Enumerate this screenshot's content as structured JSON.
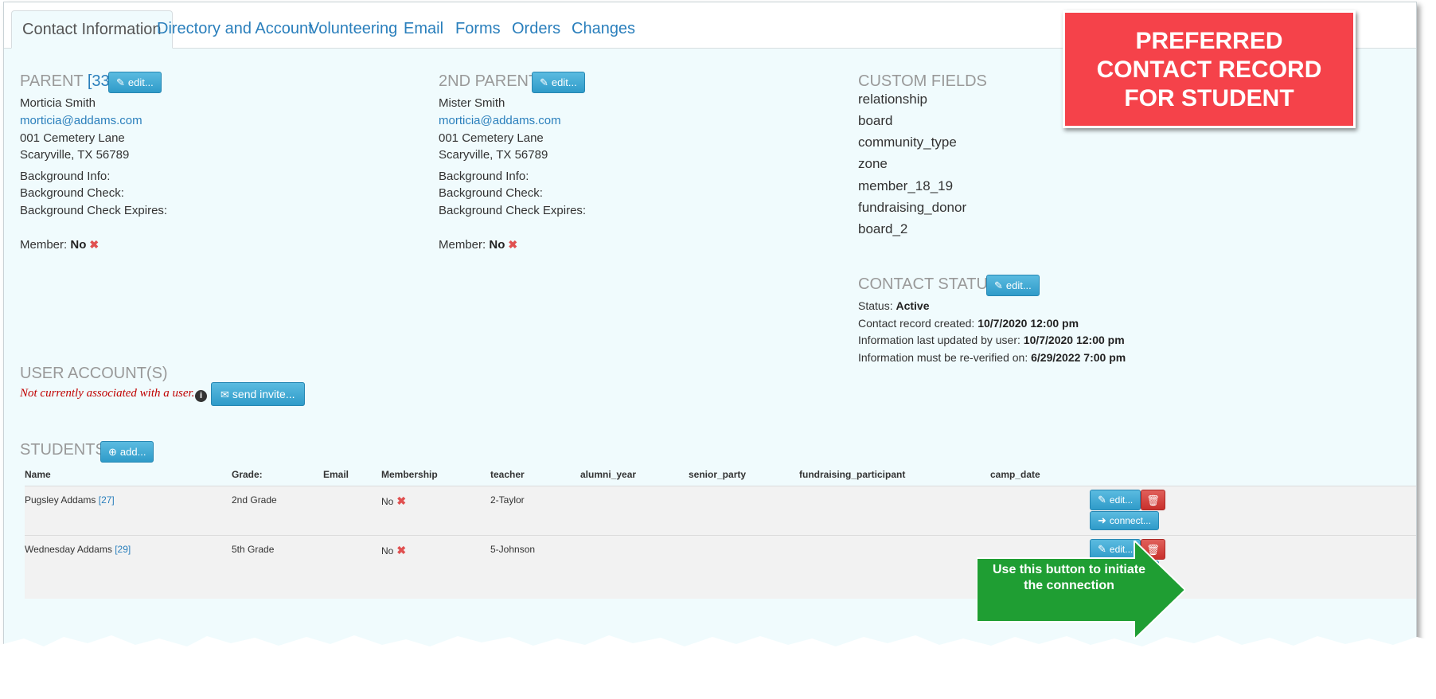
{
  "tabs": [
    {
      "label": "Contact Information",
      "active": true
    },
    {
      "label": "Directory and Account"
    },
    {
      "label": "Volunteering"
    },
    {
      "label": "Email"
    },
    {
      "label": "Forms"
    },
    {
      "label": "Orders"
    },
    {
      "label": "Changes"
    }
  ],
  "parent": {
    "title": "PARENT",
    "id": "[33]",
    "edit_label": "edit...",
    "name": "Morticia Smith",
    "email": "morticia@addams.com",
    "address1": "001 Cemetery Lane",
    "address2": "Scaryville, TX 56789",
    "bg_info": "Background Info:",
    "bg_check": "Background Check:",
    "bg_expires": "Background Check Expires:",
    "member_label": "Member:",
    "member_value": "No"
  },
  "parent2": {
    "title": "2ND PARENT",
    "edit_label": "edit...",
    "name": "Mister Smith",
    "email": "morticia@addams.com",
    "address1": "001 Cemetery Lane",
    "address2": "Scaryville, TX 56789",
    "bg_info": "Background Info:",
    "bg_check": "Background Check:",
    "bg_expires": "Background Check Expires:",
    "member_label": "Member:",
    "member_value": "No"
  },
  "custom_fields": {
    "title": "CUSTOM FIELDS",
    "items": [
      "relationship",
      "board",
      "community_type",
      "zone",
      "member_18_19",
      "fundraising_donor",
      "board_2"
    ]
  },
  "contact_status": {
    "title": "CONTACT STATUS",
    "edit_label": "edit...",
    "status_label": "Status:",
    "status_value": "Active",
    "created_label": "Contact record created:",
    "created_value": "10/7/2020 12:00 pm",
    "updated_label": "Information last updated by user:",
    "updated_value": "10/7/2020 12:00 pm",
    "reverify_label": "Information must be re-verified on:",
    "reverify_value": "6/29/2022 7:00 pm"
  },
  "user_accounts": {
    "title": "USER ACCOUNT(S)",
    "warning": "Not currently associated with a user.",
    "info_glyph": "i",
    "invite_label": "send invite..."
  },
  "students": {
    "title": "STUDENTS",
    "add_label": "add...",
    "columns": [
      "Name",
      "Grade:",
      "Email",
      "Membership",
      "teacher",
      "alumni_year",
      "senior_party",
      "fundraising_participant",
      "camp_date"
    ],
    "rows": [
      {
        "name": "Pugsley Addams",
        "id": "[27]",
        "grade": "2nd Grade",
        "email": "",
        "membership": "No",
        "teacher": "2-Taylor"
      },
      {
        "name": "Wednesday Addams",
        "id": "[29]",
        "grade": "5th Grade",
        "email": "",
        "membership": "No",
        "teacher": "5-Johnson"
      }
    ],
    "edit_label": "edit...",
    "connect_label": "connect..."
  },
  "callouts": {
    "preferred": [
      "PREFERRED",
      "CONTACT RECORD",
      "FOR STUDENT"
    ],
    "connect_hint": [
      "Use this button to initiate",
      "the connection"
    ]
  },
  "colors": {
    "accent": "#2a7fbc",
    "button": "#3aa5d2",
    "danger": "#c9302c",
    "callout_red": "#f5424a",
    "callout_green": "#1f9e33",
    "panel_bg": "#f0fbfd"
  }
}
